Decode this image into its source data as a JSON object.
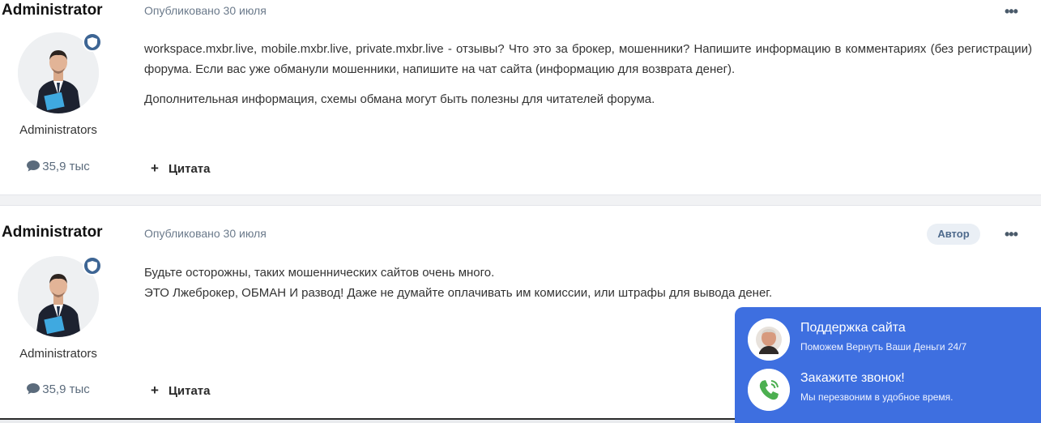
{
  "posts": [
    {
      "author": "Administrator",
      "group": "Administrators",
      "posts_count": "35,9 тыс",
      "date": "Опубликовано 30 июля",
      "menu": "•••",
      "paragraphs": [
        "workspace.mxbr.live, mobile.mxbr.live, private.mxbr.live - отзывы? Что это за брокер, мошенники? Напишите информацию в комментариях (без регистрации) форума. Если вас уже обманули мошенники, напишите на чат сайта (информацию для возврата денег).",
        "Дополнительная информация, схемы обмана могут быть полезны для читателей форума."
      ],
      "quote_label": "Цитата"
    },
    {
      "author": "Administrator",
      "group": "Administrators",
      "posts_count": "35,9 тыс",
      "date": "Опубликовано 30 июля",
      "author_badge": "Автор",
      "menu": "•••",
      "lines": [
        "Будьте осторожны, таких мошеннических сайтов очень много.",
        "ЭТО Лжеброкер, ОБМАН И развод! Даже не думайте оплачивать им комиссии, или штрафы для вывода денег."
      ],
      "quote_label": "Цитата"
    }
  ],
  "support_widget": {
    "title": "Поддержка сайта",
    "subtitle": "Поможем Вернуть Ваши Деньги 24/7",
    "call_title": "Закажите звонок!",
    "call_subtitle": "Мы перезвоним в удобное время.",
    "color": "#3e6fe0"
  },
  "icons": [
    "shield-icon",
    "comment-icon",
    "plus-icon",
    "phone-icon",
    "more-icon"
  ]
}
